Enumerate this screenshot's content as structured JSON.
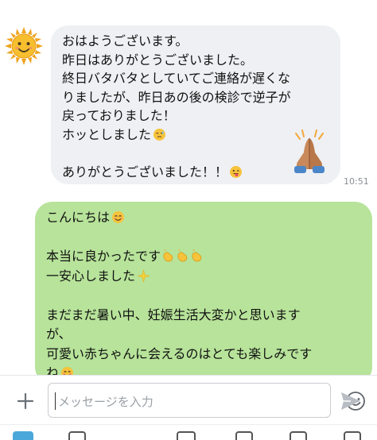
{
  "conversation": {
    "incoming": {
      "avatar_icon": "sun-face-icon",
      "lines": [
        "おはようございます。",
        "昨日はありがとうございました。",
        "終日バタバタとしていてご連絡が遅くな",
        "りましたが、昨日あの後の検診で逆子が",
        "戻っておりました！",
        "ホッとしました",
        "",
        "ありがとうございました！！"
      ],
      "sticker_icon": "folded-hands-icon",
      "time": "10:51"
    },
    "outgoing": {
      "lines": [
        "こんにちは",
        "",
        "本当に良かったです",
        "一安心しました",
        "",
        "まだまだ暑い中、妊娠生活大変かと思います",
        "が、",
        "可愛い赤ちゃんに会えるのはとても楽しみです",
        "ね"
      ]
    }
  },
  "input_bar": {
    "placeholder": "メッセージを入力",
    "icons": [
      "plus-icon",
      "smile-icon",
      "send-icon"
    ]
  },
  "colors": {
    "incoming_bubble": "#eef0f3",
    "outgoing_bubble": "#b7e39a",
    "send_icon": "#b8bcc3"
  }
}
